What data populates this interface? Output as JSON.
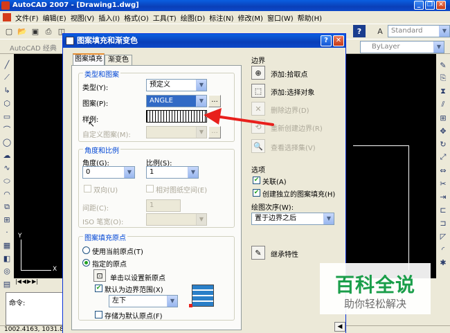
{
  "app": {
    "title": "AutoCAD 2007 - [Drawing1.dwg]"
  },
  "menu": [
    "文件(F)",
    "编辑(E)",
    "视图(V)",
    "插入(I)",
    "格式(O)",
    "工具(T)",
    "绘图(D)",
    "标注(N)",
    "修改(M)",
    "窗口(W)",
    "帮助(H)"
  ],
  "toolbar": {
    "workspace": "AutoCAD 经典",
    "text_style": "Standard",
    "layer": "ByLayer"
  },
  "command": {
    "prompt": "命令:"
  },
  "statusbar": {
    "coords": "1002.4163, 1031.86"
  },
  "dialog": {
    "title": "图案填充和渐变色",
    "help_btn": "?",
    "close_btn": "✕",
    "tabs": [
      "图案填充",
      "渐变色"
    ],
    "type_pattern": {
      "group_label": "类型和图案",
      "type_label": "类型(Y):",
      "type_value": "预定义",
      "pattern_label": "图案(P):",
      "pattern_value": "ANGLE",
      "browse_btn": "...",
      "sample_label": "样例:",
      "custom_label": "自定义图案(M):"
    },
    "angle_scale": {
      "group_label": "角度和比例",
      "angle_label": "角度(G):",
      "angle_value": "0",
      "scale_label": "比例(S):",
      "scale_value": "1",
      "double_label": "双向(U)",
      "relative_label": "相对图纸空间(E)",
      "spacing_label": "间距(C):",
      "spacing_value": "1",
      "iso_label": "ISO 笔宽(O):"
    },
    "origin": {
      "group_label": "图案填充原点",
      "use_current": "使用当前原点(T)",
      "specified": "指定的原点",
      "click_set": "单击以设置新原点",
      "default_extents": "默认为边界范围(X)",
      "extents_value": "左下",
      "store_default": "存储为默认原点(F)"
    },
    "boundaries": {
      "group_label": "边界",
      "add_pick": "添加:拾取点",
      "add_select": "添加:选择对象",
      "remove": "删除边界(D)",
      "recreate": "重新创建边界(R)",
      "view_selection": "查看选择集(V)"
    },
    "options": {
      "group_label": "选项",
      "associative": "关联(A)",
      "independent": "创建独立的图案填充(H)",
      "draw_order_label": "绘图次序(W):",
      "draw_order_value": "置于边界之后"
    },
    "inherit": "继承特性"
  },
  "watermark": {
    "title": "百科全说",
    "subtitle": "助你轻松解决"
  },
  "colors": {
    "canvas": "#000000",
    "title_blue": "#0a3fb8",
    "annotation_red": "#e8201c",
    "accent_green": "#21a121",
    "watermark_green": "#1a9e4a"
  }
}
